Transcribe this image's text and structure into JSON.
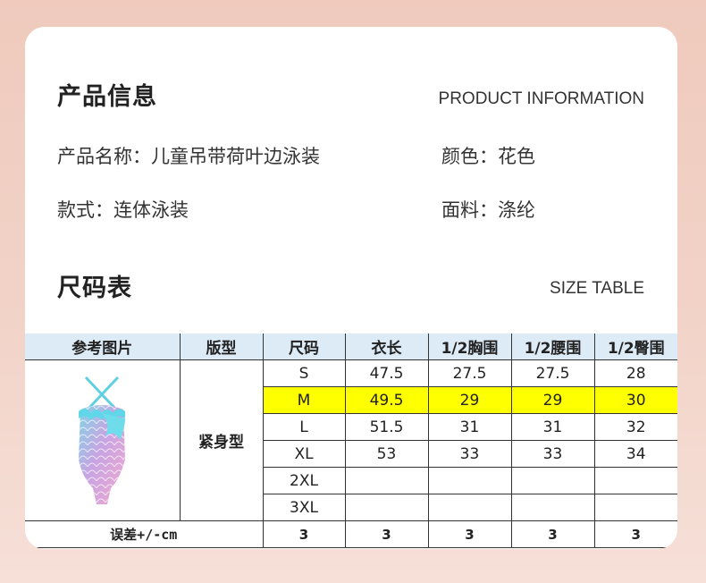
{
  "product_info": {
    "title_cn": "产品信息",
    "title_en": "PRODUCT INFORMATION",
    "name": "产品名称：儿童吊带荷叶边泳装",
    "color": "颜色：花色",
    "style": "款式：连体泳装",
    "material": "面料：涤纶"
  },
  "size_section": {
    "title_cn": "尺码表",
    "title_en": "SIZE TABLE"
  },
  "table": {
    "headers": [
      "参考图片",
      "版型",
      "尺码",
      "衣长",
      "1/2胸围",
      "1/2腰围",
      "1/2臀围"
    ],
    "fit": "紧身型",
    "rows": [
      {
        "size": "S",
        "length": "47.5",
        "chest": "27.5",
        "waist": "27.5",
        "hip": "28"
      },
      {
        "size": "M",
        "length": "49.5",
        "chest": "29",
        "waist": "29",
        "hip": "30"
      },
      {
        "size": "L",
        "length": "51.5",
        "chest": "31",
        "waist": "31",
        "hip": "32"
      },
      {
        "size": "XL",
        "length": "53",
        "chest": "33",
        "waist": "33",
        "hip": "34"
      },
      {
        "size": "2XL",
        "length": "",
        "chest": "",
        "waist": "",
        "hip": ""
      },
      {
        "size": "3XL",
        "length": "",
        "chest": "",
        "waist": "",
        "hip": ""
      }
    ],
    "highlight_color": "#ffff00",
    "header_bg": "#ddebf7",
    "error_row": {
      "label": "误差+/-cm",
      "values": [
        "3",
        "3",
        "3",
        "3",
        "3"
      ]
    }
  },
  "reference_image_icon": "swimsuit-icon"
}
